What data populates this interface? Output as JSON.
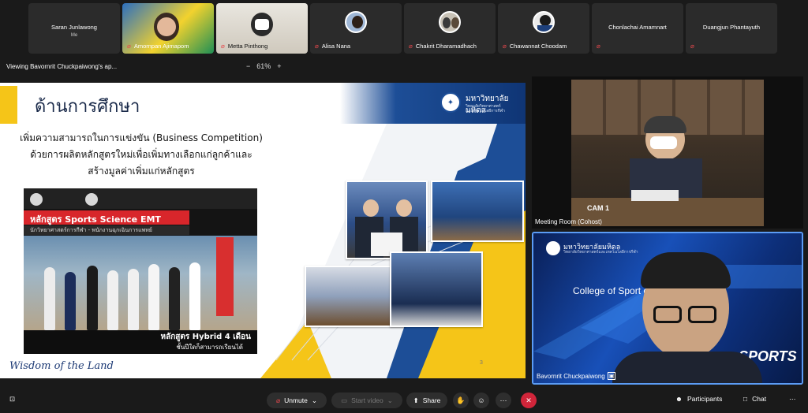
{
  "participants": [
    {
      "name": "Saran Junlawong",
      "subtitle": "Me",
      "type": "name"
    },
    {
      "name": "Amornpan Ajimapom",
      "type": "video-a"
    },
    {
      "name": "Metta Pinthong",
      "type": "video-b"
    },
    {
      "name": "Alisa Nana",
      "type": "avatar"
    },
    {
      "name": "Chakrit Dharamadhach",
      "type": "avatar"
    },
    {
      "name": "Chawannat Choodam",
      "type": "avatar"
    },
    {
      "name": "Chonlachai Amamnart",
      "type": "name"
    },
    {
      "name": "Duangjun Phantayuth",
      "type": "name"
    }
  ],
  "viewing": {
    "text": "Viewing Bavornrit Chuckpaiwong's ap...",
    "zoom_minus": "−",
    "zoom_value": "61%",
    "zoom_plus": "+"
  },
  "slide": {
    "title": "ด้านการศึกษา",
    "university": "มหาวิทยาลัยมหิดล",
    "university_sub_1": "วิทยาลัยวิทยาศาสตร์",
    "university_sub_2": "และเทคโนโลยีการกีฬา",
    "body_line_1": "เพิ่มความสามารถในการแข่งขัน (Business Competition)",
    "body_line_2": "ด้วยการผลิตหลักสูตรใหม่เพื่อเพิ่มทางเลือกแก่ลูกค้าและ",
    "body_line_3": "สร้างมูลค่าเพิ่มแก่หลักสูตร",
    "poster_title": "หลักสูตร Sports Science EMT",
    "poster_sub": "นักวิทยาศาสตร์การกีฬา - พนักงานฉุกเฉินการแพทย์",
    "poster_hybrid": "หลักสูตร Hybrid 4 เดือน",
    "poster_hybrid_2": "ชั้นปีใดก็สามารถเรียนได้",
    "footer_script": "Wisdom of the Land",
    "page_number": "3"
  },
  "videos": {
    "cohost_label": "Meeting Room (Cohost)",
    "cam_label": "CAM 1",
    "speaker_label": "Bavornrit Chuckpaiwong",
    "speaker_bg_university": "มหาวิทยาลัยมหิดล",
    "speaker_bg_sub": "วิทยาลัยวิทยาศาสตร์และเทคโนโลยีการกีฬา",
    "speaker_bg_college": "College of Sport                   chnology",
    "speaker_bg_ma": "Ma",
    "speaker_bg_sports": "SPORTS"
  },
  "toolbar": {
    "unmute": "Unmute",
    "start_video": "Start video",
    "share": "Share",
    "participants": "Participants",
    "chat": "Chat"
  }
}
